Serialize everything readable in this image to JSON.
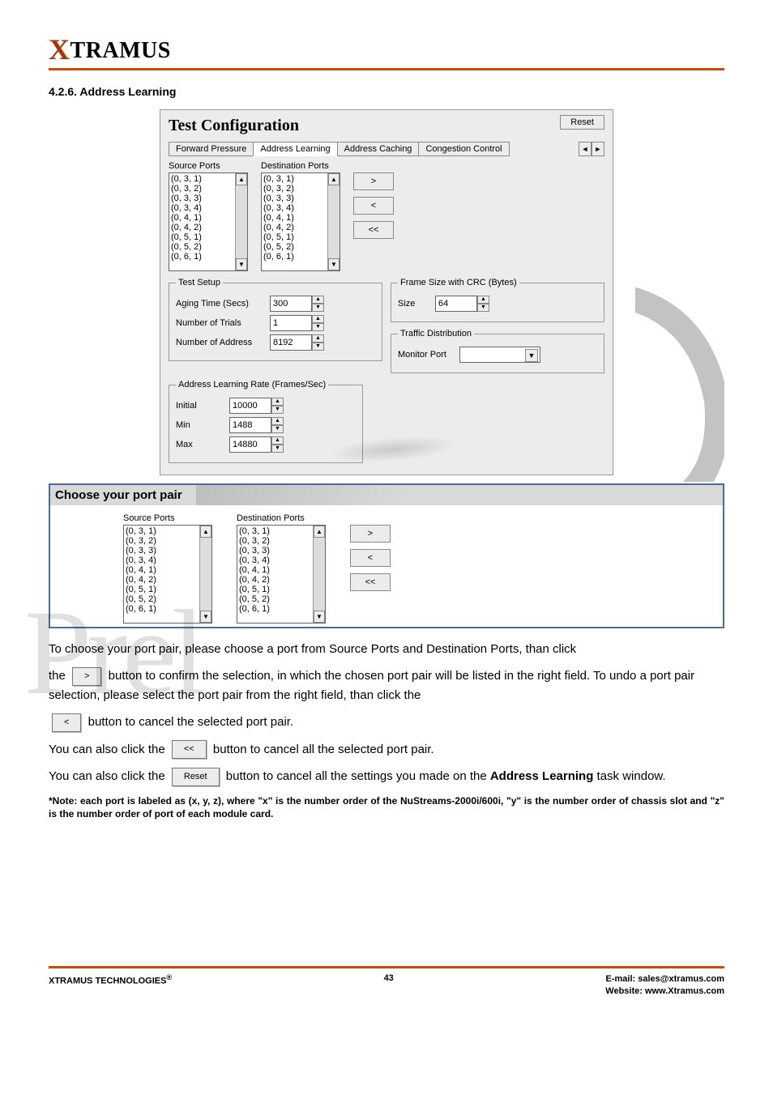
{
  "logo_text": "TRAMUS",
  "section_title": "4.2.6. Address Learning",
  "figure1": {
    "title": "Test Configuration",
    "reset": "Reset",
    "tabs": [
      "Forward Pressure",
      "Address Learning",
      "Address Caching",
      "Congestion Control"
    ],
    "source_label": "Source Ports",
    "dest_label": "Destination Ports",
    "ports": [
      "(0, 3, 1)",
      "(0, 3, 2)",
      "(0, 3, 3)",
      "(0, 3, 4)",
      "(0, 4, 1)",
      "(0, 4, 2)",
      "(0, 5, 1)",
      "(0, 5, 2)",
      "(0, 6, 1)"
    ],
    "btn_add": ">",
    "btn_remove": "<",
    "btn_clear": "<<",
    "test_setup_legend": "Test Setup",
    "aging_label": "Aging Time (Secs)",
    "aging_value": "300",
    "trials_label": "Number of Trials",
    "trials_value": "1",
    "addr_label": "Number of Address",
    "addr_value": "8192",
    "frame_legend": "Frame Size with CRC (Bytes)",
    "size_label": "Size",
    "size_value": "64",
    "traffic_legend": "Traffic Distribution",
    "monitor_label": "Monitor Port",
    "rate_legend": "Address Learning Rate (Frames/Sec)",
    "initial_label": "Initial",
    "initial_value": "10000",
    "min_label": "Min",
    "min_value": "1488",
    "max_label": "Max",
    "max_value": "14880"
  },
  "explain_head": "Choose your port pair",
  "body": {
    "p1": "To choose your port pair, please choose a port from Source Ports and Destination Ports, than click",
    "p2a": "the ",
    "p2b": " button to confirm the selection, in which the chosen port pair will be listed in the right field. To undo a port pair selection, please select the port pair from the right field, than click the",
    "p3": " button to cancel the selected port pair.",
    "p4a": "You can also click the ",
    "p4b": " button to cancel all the selected port pair.",
    "p5a": "You can also click the ",
    "p5b": " button to cancel all the settings you made on the ",
    "p5c": "Address Learning",
    "p5d": " task window.",
    "reset_btn": "Reset"
  },
  "note": "*Note: each port is labeled as (x, y, z), where \"x\" is the number order of the NuStreams-2000i/600i, \"y\" is the number order of chassis slot and \"z\" is the number order of port of each module card.",
  "footer": {
    "left": "XTRAMUS TECHNOLOGIES",
    "page": "43",
    "email_label": "E-mail: ",
    "email": "sales@xtramus.com",
    "site_label": "Website:  ",
    "site": "www.Xtramus.com"
  }
}
